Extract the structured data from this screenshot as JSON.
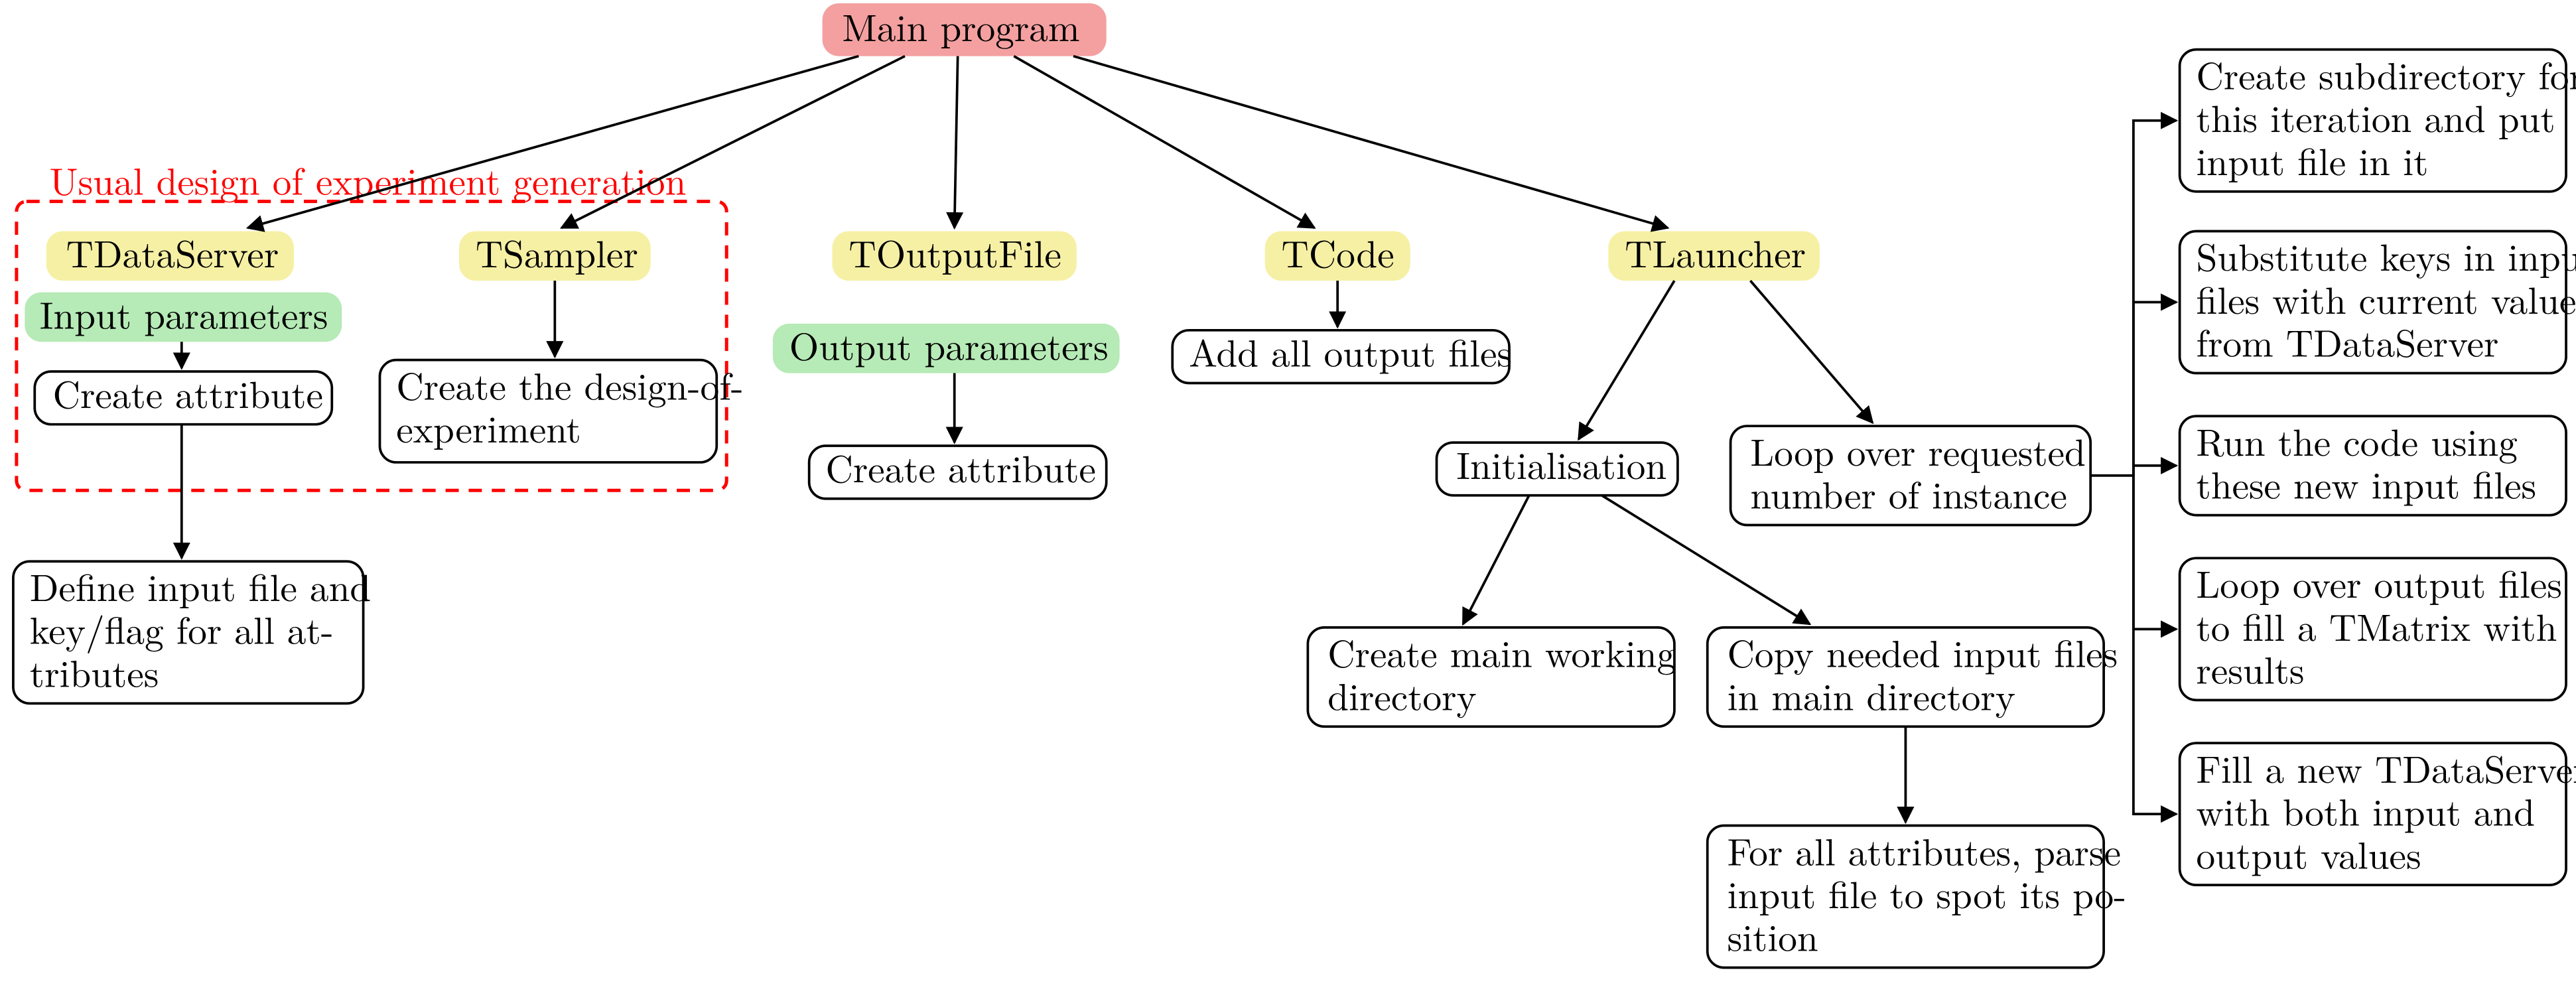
{
  "root": "Main program",
  "groupLabel": "Usual design of experiment generation",
  "tdataserver": {
    "title": "TDataServer",
    "sub": "Input parameters",
    "step1": "Create attribute",
    "step2a": "Define input file and",
    "step2b": "key/flag for all at-",
    "step2c": "tributes"
  },
  "tsampler": {
    "title": "TSampler",
    "step1a": "Create the design-of-",
    "step1b": "experiment"
  },
  "toutputfile": {
    "title": "TOutputFile",
    "sub": "Output parameters",
    "step1": "Create attribute"
  },
  "tcode": {
    "title": "TCode",
    "step1": "Add all output files"
  },
  "tlauncher": {
    "title": "TLauncher",
    "init": "Initialisation",
    "initAa": "Create main working",
    "initAb": "directory",
    "initBa": "Copy needed input files",
    "initBb": "in main directory",
    "initCa": "For all attributes, parse",
    "initCb": "input file to spot its po-",
    "initCc": "sition",
    "loopA": "Loop over requested",
    "loopB": "number of instance",
    "s1a": "Create subdirectory for",
    "s1b": "this iteration and put",
    "s1c": "input file in it",
    "s2a": "Substitute keys in input",
    "s2b": "files with current values",
    "s2c": "from TDataServer",
    "s3a": "Run the code using",
    "s3b": "these new input files",
    "s4a": "Loop over output files",
    "s4b": "to fill a TMatrix with",
    "s4c": "results",
    "s5a": "Fill a new TDataServer",
    "s5b": "with  both  input  and",
    "s5c": "output values"
  }
}
